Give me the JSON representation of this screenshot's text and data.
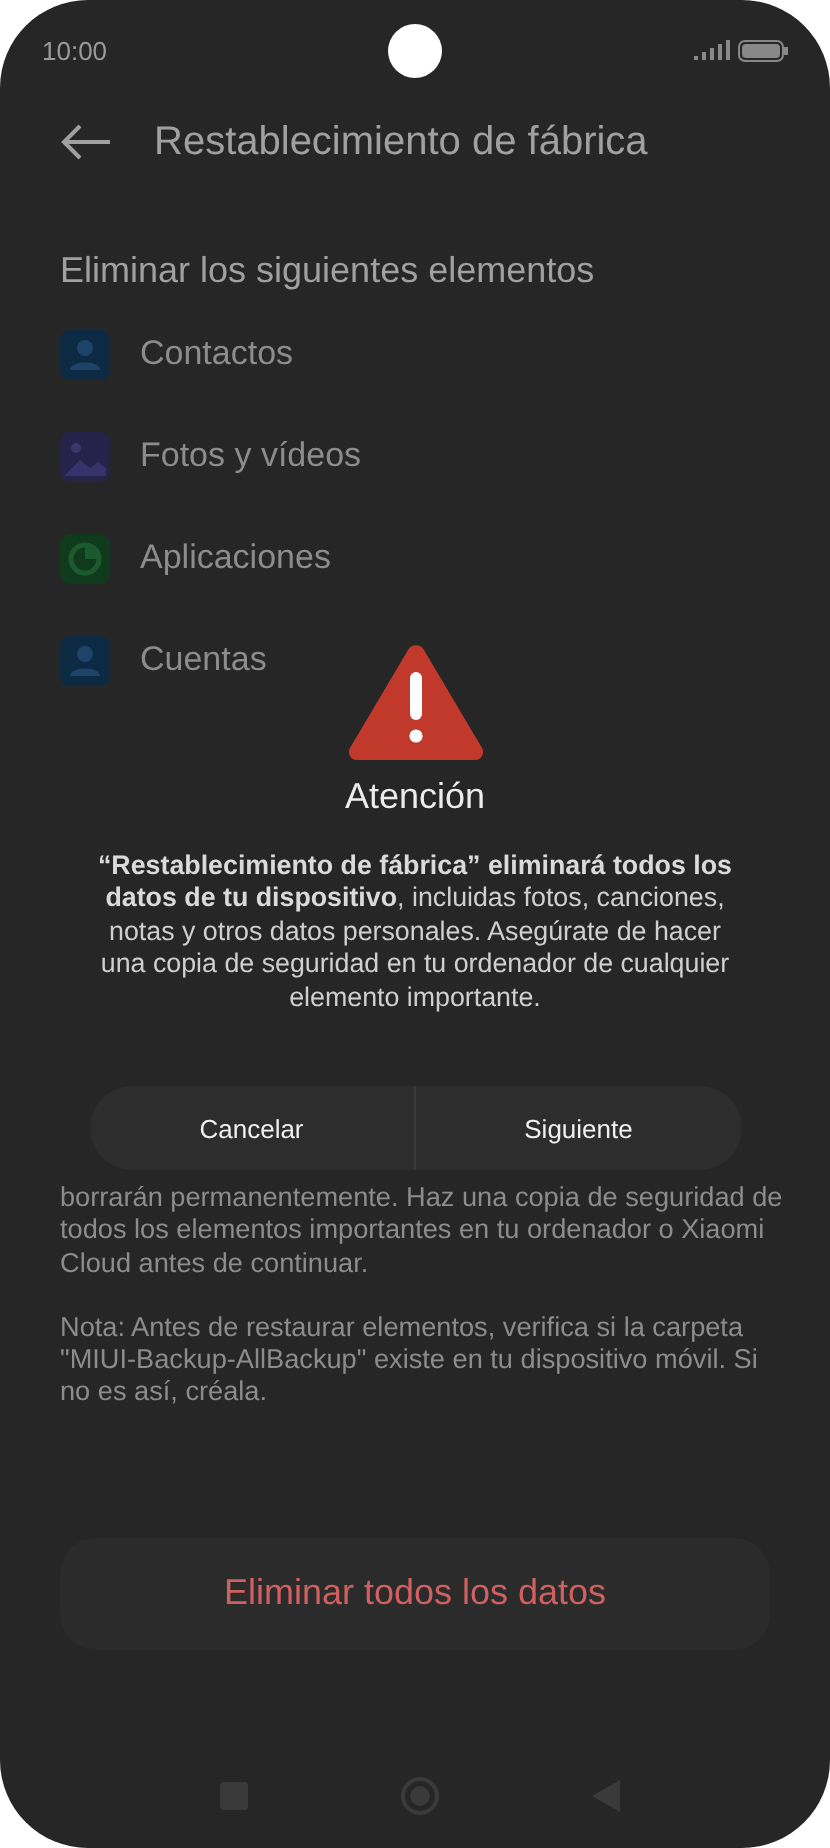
{
  "status_bar": {
    "time": "10:00"
  },
  "header": {
    "title": "Restablecimiento de fábrica"
  },
  "section": {
    "title": "Eliminar los siguientes elementos"
  },
  "items": [
    {
      "label": "Contactos",
      "kind": "contacts",
      "color": "#0d2a45"
    },
    {
      "label": "Fotos y vídeos",
      "kind": "photos",
      "color": "#26234a"
    },
    {
      "label": "Aplicaciones",
      "kind": "apps",
      "color": "#0f3a1c"
    },
    {
      "label": "Cuentas",
      "kind": "accounts",
      "color": "#0d2a45"
    }
  ],
  "notes": [
    "borrarán permanentemente. Haz una copia de seguridad de todos los elementos importantes en tu ordenador o Xiaomi Cloud antes de continuar.",
    "Nota: Antes de restaurar elementos, verifica si la carpeta \"MIUI-Backup-AllBackup\" existe en tu dispositivo móvil. Si no es así, créala."
  ],
  "primary_button": "Eliminar todos los datos",
  "dialog": {
    "title": "Atención",
    "message": "**“Restablecimiento de fábrica” eliminará todos los datos de tu dispositivo**, incluidas fotos, canciones, notas y otros datos personales. Asegúrate de hacer una copia de seguridad en tu ordenador de cualquier elemento importante.",
    "buttons": [
      "Cancelar",
      "Siguiente"
    ]
  }
}
